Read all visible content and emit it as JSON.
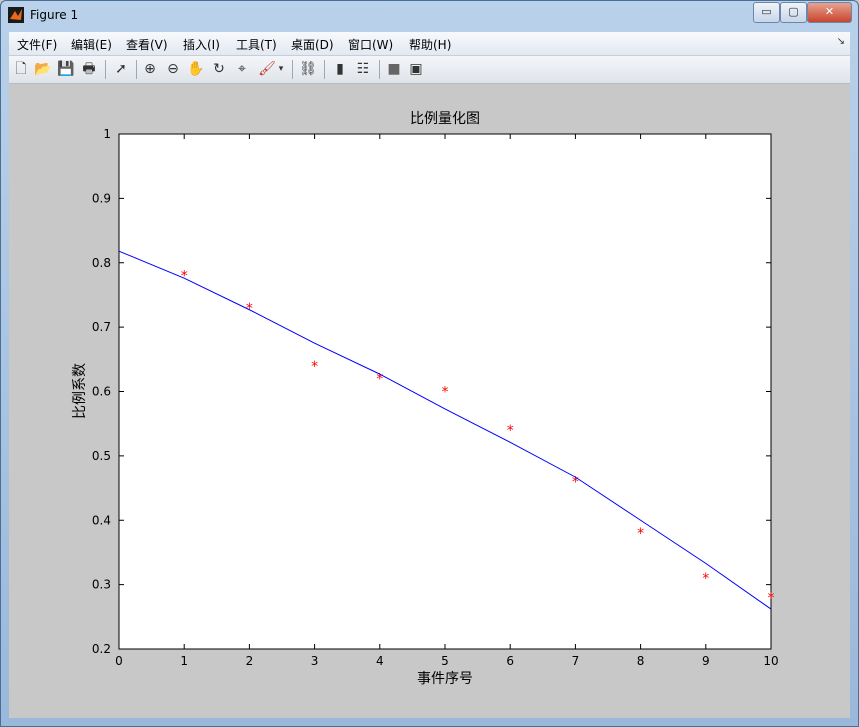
{
  "window": {
    "title": "Figure 1",
    "min_label": "▭",
    "max_label": "▢",
    "close_label": "✕"
  },
  "menu": {
    "items": [
      {
        "label": "文件(F)"
      },
      {
        "label": "编辑(E)"
      },
      {
        "label": "查看(V)"
      },
      {
        "label": "插入(I)"
      },
      {
        "label": "工具(T)"
      },
      {
        "label": "桌面(D)"
      },
      {
        "label": "窗口(W)"
      },
      {
        "label": "帮助(H)"
      }
    ],
    "overflow_label": "↘"
  },
  "toolbar": {
    "icons": [
      "new-figure-icon",
      "open-file-icon",
      "save-icon",
      "print-icon",
      "pointer-icon",
      "zoom-in-icon",
      "zoom-out-icon",
      "pan-hand-icon",
      "rotate-3d-icon",
      "data-cursor-icon",
      "brush-icon",
      "brush-dropdown-icon",
      "link-plot-icon",
      "colorbar-icon",
      "legend-icon",
      "hide-plot-tools-icon",
      "show-plot-tools-icon"
    ]
  },
  "chart_data": {
    "type": "scatter",
    "title": "比例量化图",
    "xlabel": "事件序号",
    "ylabel": "比例系数",
    "xlim": [
      0,
      10
    ],
    "ylim": [
      0.2,
      1
    ],
    "xticks": [
      "0",
      "1",
      "2",
      "3",
      "4",
      "5",
      "6",
      "7",
      "8",
      "9",
      "10"
    ],
    "yticks": [
      "0.2",
      "0.3",
      "0.4",
      "0.5",
      "0.6",
      "0.7",
      "0.8",
      "0.9",
      "1"
    ],
    "grid": false,
    "series": [
      {
        "marker": "*",
        "color": "#ff0000",
        "x": [
          1,
          2,
          3,
          4,
          5,
          6,
          7,
          8,
          9,
          10
        ],
        "y": [
          0.78,
          0.73,
          0.64,
          0.62,
          0.6,
          0.54,
          0.46,
          0.38,
          0.31,
          0.28
        ]
      },
      {
        "line": "fit",
        "color": "#0000ff",
        "x": [
          0,
          1,
          2,
          3,
          4,
          5,
          6,
          7,
          8,
          9,
          10
        ],
        "y": [
          0.818,
          0.776,
          0.727,
          0.675,
          0.627,
          0.573,
          0.521,
          0.467,
          0.4,
          0.333,
          0.262
        ]
      }
    ]
  }
}
